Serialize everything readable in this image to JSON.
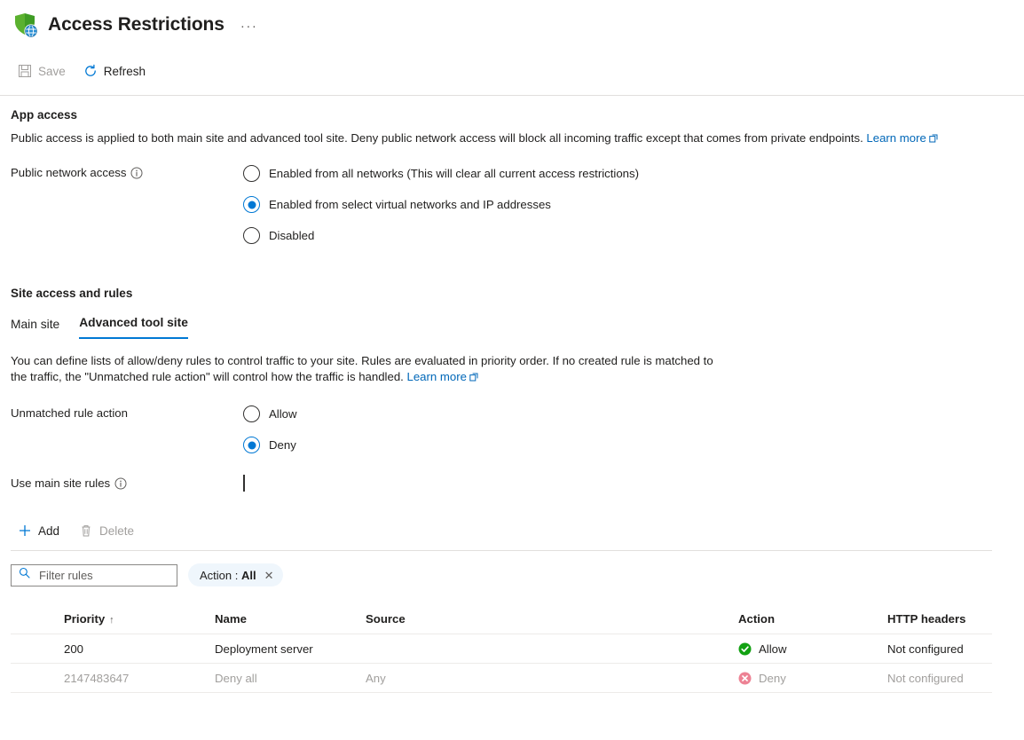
{
  "header": {
    "title": "Access Restrictions",
    "icon": "shield-globe-icon",
    "more_label": "···"
  },
  "commandbar": {
    "save_label": "Save",
    "save_icon": "save-floppy-icon",
    "save_disabled": true,
    "refresh_label": "Refresh",
    "refresh_icon": "refresh-icon",
    "refresh_disabled": false
  },
  "app_access": {
    "section_title": "App access",
    "description": "Public access is applied to both main site and advanced tool site. Deny public network access will block all incoming traffic except that comes from private endpoints.",
    "learn_more": "Learn more",
    "field_label": "Public network access",
    "info_icon": "info-icon",
    "options": [
      {
        "label": "Enabled from all networks (This will clear all current access restrictions)",
        "selected": false
      },
      {
        "label": "Enabled from select virtual networks and IP addresses",
        "selected": true
      },
      {
        "label": "Disabled",
        "selected": false
      }
    ]
  },
  "site_access": {
    "section_title": "Site access and rules",
    "tabs": [
      {
        "label": "Main site",
        "active": false
      },
      {
        "label": "Advanced tool site",
        "active": true
      }
    ],
    "description": "You can define lists of allow/deny rules to control traffic to your site. Rules are evaluated in priority order. If no created rule is matched to the traffic, the \"Unmatched rule action\" will control how the traffic is handled.",
    "learn_more": "Learn more",
    "unmatched_label": "Unmatched rule action",
    "unmatched_options": [
      {
        "label": "Allow",
        "selected": false
      },
      {
        "label": "Deny",
        "selected": true
      }
    ],
    "use_main_rules_label": "Use main site rules",
    "use_main_rules_checked": false
  },
  "table_toolbar": {
    "add_label": "Add",
    "add_icon": "plus-icon",
    "add_disabled": false,
    "delete_label": "Delete",
    "delete_icon": "trash-icon",
    "delete_disabled": true
  },
  "filter": {
    "search_placeholder": "Filter rules",
    "search_value": "",
    "search_icon": "search-icon",
    "pill_label": "Action :",
    "pill_value": "All",
    "pill_close_icon": "close-icon"
  },
  "rules_table": {
    "columns": {
      "priority": "Priority",
      "sort_arrow": "↑",
      "name": "Name",
      "source": "Source",
      "action": "Action",
      "http_headers": "HTTP headers"
    },
    "rows": [
      {
        "priority": "200",
        "name": "Deployment server",
        "source": "",
        "action": "Allow",
        "action_icon": "allow-check-icon",
        "http_headers": "Not configured",
        "muted": false
      },
      {
        "priority": "2147483647",
        "name": "Deny all",
        "source": "Any",
        "action": "Deny",
        "action_icon": "deny-x-icon",
        "http_headers": "Not configured",
        "muted": true
      }
    ]
  },
  "colors": {
    "accent": "#0078d4",
    "link": "#0067b8",
    "allow_green": "#107c10",
    "deny_red": "#e87a8c",
    "pill_bg": "#eff6fc",
    "disabled_text": "#a19f9d"
  }
}
